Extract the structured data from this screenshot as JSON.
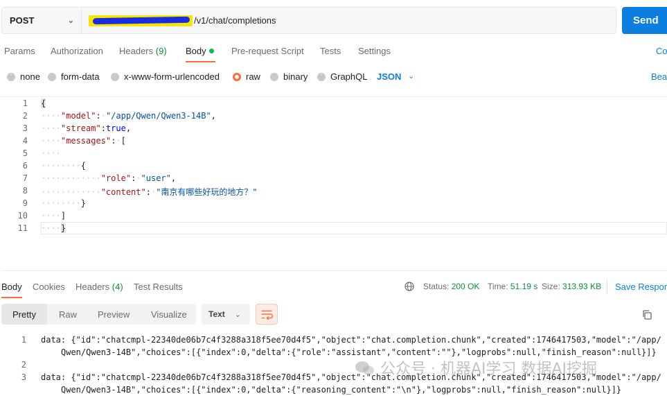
{
  "request": {
    "method": "POST",
    "url_suffix": "/v1/chat/completions",
    "send_label": "Send"
  },
  "tabs": {
    "params": "Params",
    "authorization": "Authorization",
    "headers": "Headers",
    "headers_count": "(9)",
    "body": "Body",
    "prerequest": "Pre-request Script",
    "tests": "Tests",
    "settings": "Settings",
    "cookies_cut": "Co"
  },
  "body_types": {
    "none": "none",
    "form_data": "form-data",
    "urlencoded": "x-www-form-urlencoded",
    "raw": "raw",
    "binary": "binary",
    "graphql": "GraphQL",
    "format": "JSON",
    "beautify_cut": "Beau"
  },
  "editor": {
    "line_numbers": [
      "1",
      "2",
      "3",
      "4",
      "5",
      "6",
      "7",
      "8",
      "9",
      "10",
      "11"
    ],
    "model_key": "\"model\"",
    "model_val": "\"/app/Qwen/Qwen3-14B\"",
    "stream_key": "\"stream\"",
    "stream_val": "true",
    "messages_key": "\"messages\"",
    "role_key": "\"role\"",
    "role_val": "\"user\"",
    "content_key": "\"content\"",
    "content_val": "\"南京有哪些好玩的地方？\""
  },
  "response": {
    "tabs": {
      "body": "Body",
      "cookies": "Cookies",
      "headers": "Headers",
      "headers_count": "(4)",
      "test_results": "Test Results"
    },
    "status_label": "Status:",
    "status_value": "200 OK",
    "time_label": "Time:",
    "time_value": "51.19 s",
    "size_label": "Size:",
    "size_value": "313.93 KB",
    "save_label": "Save Respon",
    "views": {
      "pretty": "Pretty",
      "raw": "Raw",
      "preview": "Preview",
      "visualize": "Visualize"
    },
    "text_format": "Text",
    "lines": [
      {
        "num": "1",
        "l1": "data: {\"id\":\"chatcmpl-22340de06b7c4f3288a318f5ee70d4f5\",\"object\":\"chat.completion.chunk\",\"created\":1746417503,\"model\":\"/app/",
        "l2": "Qwen/Qwen3-14B\",\"choices\":[{\"index\":0,\"delta\":{\"role\":\"assistant\",\"content\":\"\"},\"logprobs\":null,\"finish_reason\":null}]}"
      },
      {
        "num": "2",
        "l1": "",
        "l2": ""
      },
      {
        "num": "3",
        "l1": "data: {\"id\":\"chatcmpl-22340de06b7c4f3288a318f5ee70d4f5\",\"object\":\"chat.completion.chunk\",\"created\":1746417503,\"model\":\"/app/",
        "l2": "Qwen/Qwen3-14B\",\"choices\":[{\"index\":0,\"delta\":{\"reasoning_content\":\"\\n\"},\"logprobs\":null,\"finish_reason\":null}]}"
      }
    ]
  },
  "watermark": "公众号 · 机器AI学习 数据AI挖掘",
  "colors": {
    "accent": "#ff6c37",
    "send": "#0b7ee0",
    "status_ok": "#0c8f3c"
  }
}
